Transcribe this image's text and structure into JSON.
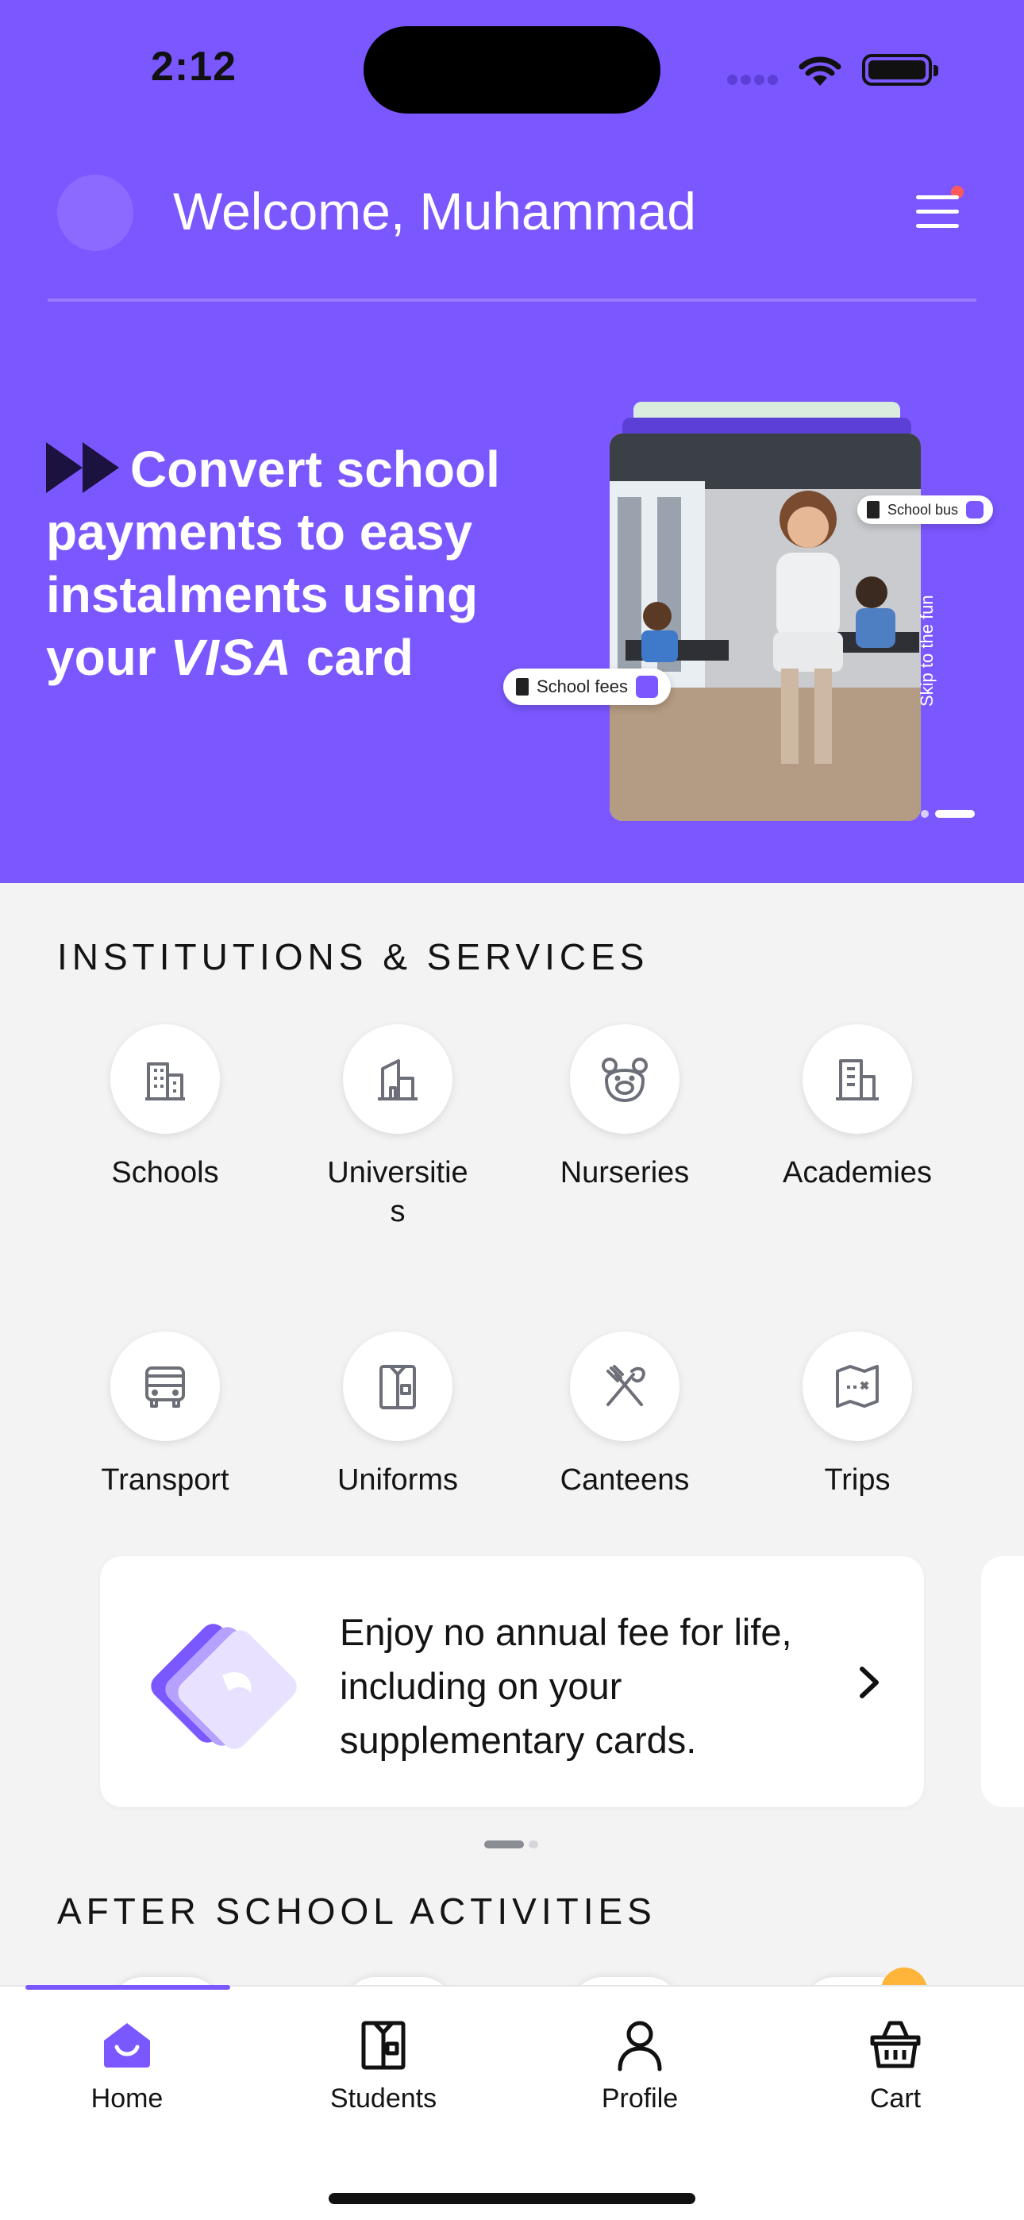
{
  "status": {
    "time": "2:12"
  },
  "header": {
    "welcome": "Welcome, Muhammad"
  },
  "banner": {
    "line1": "Convert school",
    "line2": "payments to easy",
    "line3": "instalments using",
    "line4_pre": "your",
    "line4_brand": "VISA",
    "line4_post": "card",
    "chip_fees": "School fees",
    "chip_bus": "School bus",
    "skip_label": "Skip to the fun"
  },
  "institutions": {
    "title": "INSTITUTIONS & SERVICES",
    "items": [
      {
        "label": "Schools",
        "icon": "school-building-icon"
      },
      {
        "label_line1": "Universitie",
        "label_line2": "s",
        "icon": "university-building-icon"
      },
      {
        "label": "Nurseries",
        "icon": "teddy-bear-icon"
      },
      {
        "label": "Academies",
        "icon": "academy-building-icon"
      },
      {
        "label": "Transport",
        "icon": "bus-icon"
      },
      {
        "label": "Uniforms",
        "icon": "uniform-icon"
      },
      {
        "label": "Canteens",
        "icon": "utensils-icon"
      },
      {
        "label": "Trips",
        "icon": "map-icon"
      }
    ]
  },
  "promo": {
    "text": "Enjoy no annual fee for life, including on your supplementary cards."
  },
  "activities": {
    "title": "AFTER SCHOOL ACTIVITIES"
  },
  "tabbar": {
    "items": [
      {
        "label": "Home",
        "icon": "home-icon",
        "active": true
      },
      {
        "label": "Students",
        "icon": "uniform-icon"
      },
      {
        "label": "Profile",
        "icon": "person-icon"
      },
      {
        "label": "Cart",
        "icon": "basket-icon"
      }
    ]
  },
  "colors": {
    "brand": "#7b57ff",
    "background": "#f3f3f4",
    "card": "#ffffff",
    "text": "#141414"
  }
}
